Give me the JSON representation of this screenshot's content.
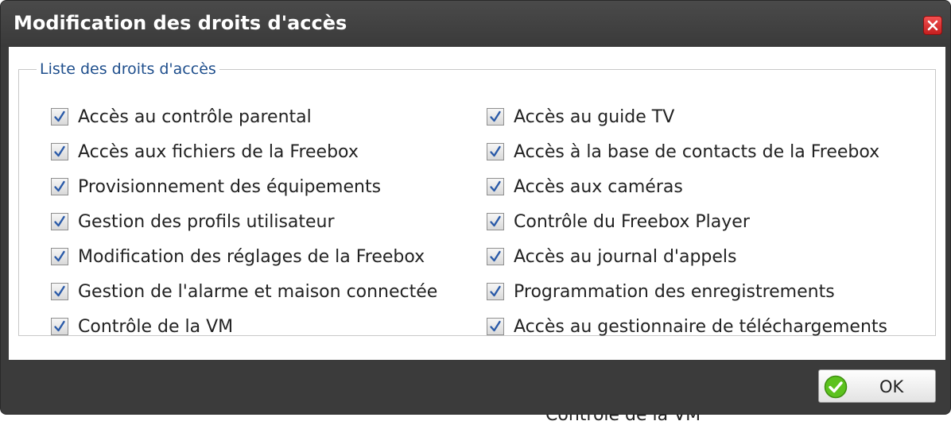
{
  "dialog": {
    "title": "Modification des droits d'accès",
    "close_icon": "close-icon",
    "fieldset_legend": "Liste des droits d'accès",
    "permissions_left": [
      {
        "label": "Accès au contrôle parental",
        "checked": true
      },
      {
        "label": "Accès aux fichiers de la Freebox",
        "checked": true
      },
      {
        "label": "Provisionnement des équipements",
        "checked": true
      },
      {
        "label": "Gestion des profils utilisateur",
        "checked": true
      },
      {
        "label": "Modification des réglages de la Freebox",
        "checked": true
      },
      {
        "label": "Gestion de l'alarme et maison connectée",
        "checked": true
      },
      {
        "label": "Contrôle de la VM",
        "checked": true
      }
    ],
    "permissions_right": [
      {
        "label": "Accès au guide TV",
        "checked": true
      },
      {
        "label": "Accès à la base de contacts de la Freebox",
        "checked": true
      },
      {
        "label": "Accès aux caméras",
        "checked": true
      },
      {
        "label": "Contrôle du Freebox Player",
        "checked": true
      },
      {
        "label": "Accès au journal d'appels",
        "checked": true
      },
      {
        "label": "Programmation des enregistrements",
        "checked": true
      },
      {
        "label": "Accès au gestionnaire de téléchargements",
        "checked": true
      }
    ],
    "ok_label": "OK",
    "ok_icon": "check-circle-icon"
  },
  "background": {
    "partial_text": "Contrôle de la VM"
  },
  "colors": {
    "dialog_dark": "#3b3b3b",
    "legend_blue": "#1e4e8c",
    "close_red": "#d42a2a",
    "ok_green": "#5cc21e"
  }
}
